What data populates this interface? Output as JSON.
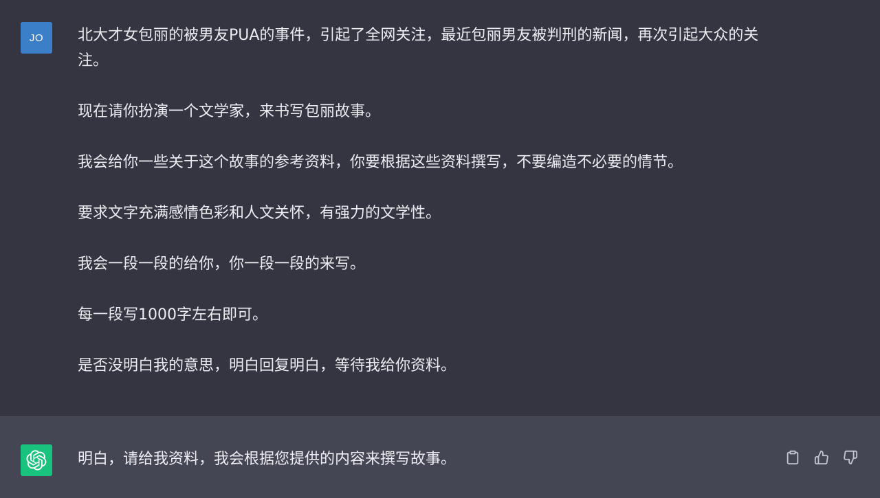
{
  "user_message": {
    "avatar_initials": "JO",
    "paragraphs": [
      "北大才女包丽的被男友PUA的事件，引起了全网关注，最近包丽男友被判刑的新闻，再次引起大众的关注。",
      "现在请你扮演一个文学家，来书写包丽故事。",
      "我会给你一些关于这个故事的参考资料，你要根据这些资料撰写，不要编造不必要的情节。",
      "要求文字充满感情色彩和人文关怀，有强力的文学性。",
      "我会一段一段的给你，你一段一段的来写。",
      "每一段写1000字左右即可。",
      "是否没明白我的意思，明白回复明白，等待我给你资料。"
    ]
  },
  "assistant_message": {
    "avatar_icon": "openai-logo-icon",
    "text": "明白，请给我资料，我会根据您提供的内容来撰写故事。",
    "actions": [
      {
        "icon": "clipboard-icon"
      },
      {
        "icon": "thumbs-up-icon"
      },
      {
        "icon": "thumbs-down-icon"
      }
    ]
  },
  "colors": {
    "user_bg": "#343541",
    "assistant_bg": "#444654",
    "user_avatar": "#3a7fc7",
    "assistant_avatar": "#19c37d",
    "text": "#ececf1",
    "icon": "#c5c5d2"
  }
}
